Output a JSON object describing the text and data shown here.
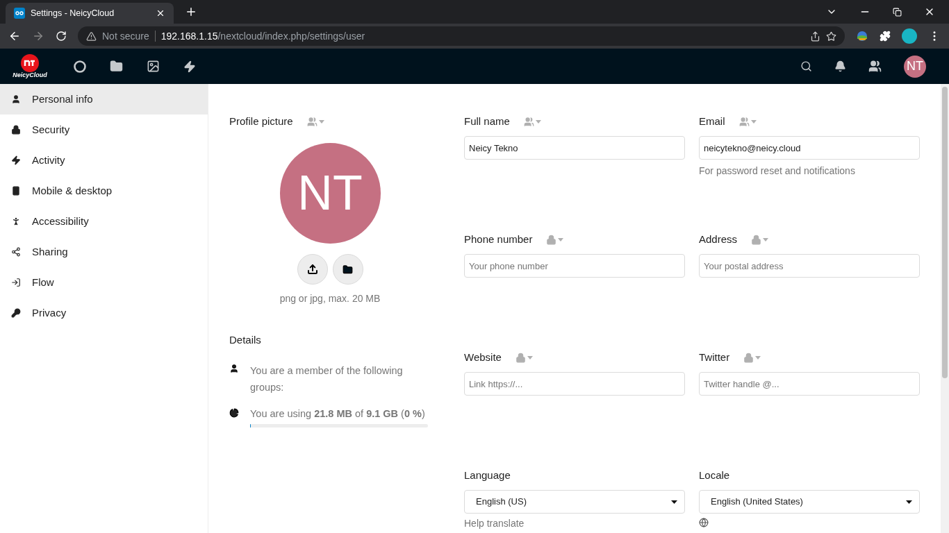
{
  "browser": {
    "tab_title": "Settings - NeicyCloud",
    "security": "Not secure",
    "url_host": "192.168.1.15",
    "url_path": "/nextcloud/index.php/settings/user"
  },
  "header": {
    "logo": "NeicyCloud",
    "avatar": "NT"
  },
  "sidebar": {
    "items": [
      {
        "label": "Personal info",
        "selected": true
      },
      {
        "label": "Security",
        "selected": false
      },
      {
        "label": "Activity",
        "selected": false
      },
      {
        "label": "Mobile & desktop",
        "selected": false
      },
      {
        "label": "Accessibility",
        "selected": false
      },
      {
        "label": "Sharing",
        "selected": false
      },
      {
        "label": "Flow",
        "selected": false
      },
      {
        "label": "Privacy",
        "selected": false
      }
    ]
  },
  "profile_picture": {
    "label": "Profile picture",
    "visibility": {
      "kind": "contacts"
    },
    "avatar": "NT",
    "hint": "png or jpg, max. 20 MB"
  },
  "details": {
    "title": "Details",
    "groups": "You are a member of the following groups:",
    "usage": "You are using **21.8 MB** of **9.1 GB** (**0 %**)",
    "level": 0.003
  },
  "fields": [
    {
      "kind": "text",
      "label": "Full name",
      "visibility": {
        "kind": "contacts"
      },
      "value": "Neicy Tekno"
    },
    {
      "kind": "text",
      "label": "Email",
      "visibility": {
        "kind": "contacts"
      },
      "value": "neicytekno@neicy.cloud",
      "hint": "For password reset and notifications"
    },
    {
      "kind": "text",
      "label": "Phone number",
      "visibility": {
        "kind": "private"
      },
      "placeholder": "Your phone number"
    },
    {
      "kind": "text",
      "label": "Address",
      "visibility": {
        "kind": "private"
      },
      "placeholder": "Your postal address"
    },
    {
      "kind": "text",
      "label": "Website",
      "visibility": {
        "kind": "private"
      },
      "placeholder": "Link https://..."
    },
    {
      "kind": "text",
      "label": "Twitter",
      "visibility": {
        "kind": "private"
      },
      "placeholder": "Twitter handle @..."
    },
    {
      "kind": "select",
      "label": "Language",
      "value": "English (US)",
      "link": "Help translate"
    },
    {
      "kind": "select",
      "label": "Locale",
      "value": "English (United States)",
      "globe": true
    }
  ]
}
